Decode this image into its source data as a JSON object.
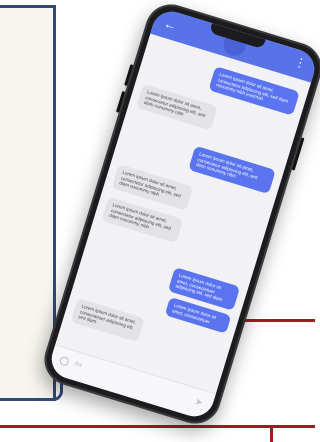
{
  "phone": {
    "header": {
      "back_icon": "←",
      "more_icon": "⋮"
    },
    "messages": [
      {
        "direction": "sent",
        "text": "Lorem ipsum dolor sit amet, consectetur adipiscing elit, sed diam nonummy nibh euismod"
      },
      {
        "direction": "received",
        "text": "Lorem ipsum dolor sit amet, consectetur adipiscing elit, sed diam nonummy nibh"
      },
      {
        "direction": "sent",
        "text": "Lorem ipsum dolor sit amet, consectetur adipiscing elit, sed diam nonummy nibh"
      },
      {
        "direction": "received",
        "text": "Lorem ipsum dolor sit amet, consectetur adipiscing elit, sed diam nonummy nibh"
      },
      {
        "direction": "received",
        "text": "Lorem ipsum dolor sit amet, consectetur adipiscing elit, sed diam nonummy nibh"
      },
      {
        "direction": "sent",
        "text": "Lorem ipsum dolor sit amet, consectetuer adipiscing elit, sed diam"
      },
      {
        "direction": "sent",
        "text": "Lorem ipsum dolor sit amet, consectetuer"
      },
      {
        "direction": "received",
        "text": "Lorem ipsum dolor sit amet, consectetuer adipiscing elit, sed diam"
      }
    ],
    "composer": {
      "placeholder": "Aa",
      "send_icon": "➤"
    }
  },
  "colors": {
    "header": "#5872e8",
    "sent_bubble": "#5a74f0",
    "received_bubble": "#e3e3e7",
    "frame_blue": "#324a78",
    "accent_red": "#a31a20"
  }
}
